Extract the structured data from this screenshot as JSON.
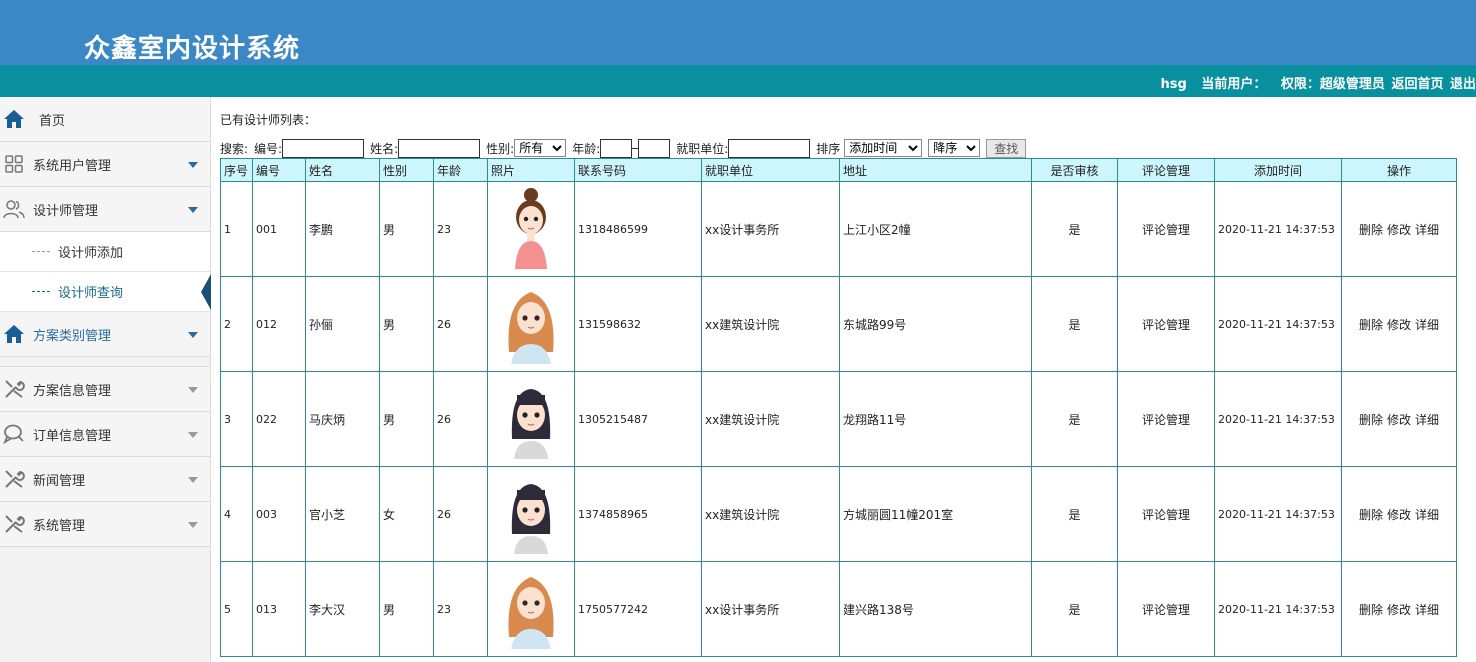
{
  "header": {
    "title": "众鑫室内设计系统",
    "username": "hsg",
    "current_user_label": "当前用户：",
    "role_label": "权限：超级管理员",
    "home_link": "返回首页",
    "logout_link": "退出"
  },
  "sidebar": {
    "home": "首页",
    "items": [
      {
        "label": "系统用户管理",
        "icon": "grid-icon"
      },
      {
        "label": "设计师管理",
        "icon": "users-icon"
      },
      {
        "label": "方案类别管理",
        "icon": "home-icon"
      },
      {
        "label": "方案信息管理",
        "icon": "tools-icon"
      },
      {
        "label": "订单信息管理",
        "icon": "chat-icon"
      },
      {
        "label": "新闻管理",
        "icon": "tools-icon"
      },
      {
        "label": "系统管理",
        "icon": "tools-icon"
      }
    ],
    "subitems": [
      "设计师添加",
      "设计师查询"
    ]
  },
  "main": {
    "caption": "已有设计师列表：",
    "search": {
      "label": "搜索:",
      "no_label": "编号:",
      "name_label": "姓名:",
      "sex_label": "性别:",
      "sex_value": "所有",
      "age_label": "年龄:",
      "unit_label": "就职单位:",
      "sort_label": "排序",
      "sort_value": "添加时间",
      "order_value": "降序",
      "button": "查找"
    },
    "columns": [
      "序号",
      "编号",
      "姓名",
      "性别",
      "年龄",
      "照片",
      "联系号码",
      "就职单位",
      "地址",
      "是否审核",
      "评论管理",
      "添加时间",
      "操作"
    ],
    "rows": [
      {
        "idx": "1",
        "no": "001",
        "name": "李鹏",
        "sex": "男",
        "age": "23",
        "phone": "1318486599",
        "unit": "xx设计事务所",
        "addr": "上江小区2幢",
        "audit": "是",
        "comment": "评论管理",
        "time": "2020-11-21 14:37:53",
        "photo": "avatar-bun"
      },
      {
        "idx": "2",
        "no": "012",
        "name": "孙俪",
        "sex": "男",
        "age": "26",
        "phone": "131598632",
        "unit": "xx建筑设计院",
        "addr": "东城路99号",
        "audit": "是",
        "comment": "评论管理",
        "time": "2020-11-21 14:37:53",
        "photo": "avatar-long"
      },
      {
        "idx": "3",
        "no": "022",
        "name": "马庆炳",
        "sex": "男",
        "age": "26",
        "phone": "1305215487",
        "unit": "xx建筑设计院",
        "addr": "龙翔路11号",
        "audit": "是",
        "comment": "评论管理",
        "time": "2020-11-21 14:37:53",
        "photo": "avatar-dark"
      },
      {
        "idx": "4",
        "no": "003",
        "name": "官小芝",
        "sex": "女",
        "age": "26",
        "phone": "1374858965",
        "unit": "xx建筑设计院",
        "addr": "方城丽圆11幢201室",
        "audit": "是",
        "comment": "评论管理",
        "time": "2020-11-21 14:37:53",
        "photo": "avatar-dark"
      },
      {
        "idx": "5",
        "no": "013",
        "name": "李大汉",
        "sex": "男",
        "age": "23",
        "phone": "1750577242",
        "unit": "xx设计事务所",
        "addr": "建兴路138号",
        "audit": "是",
        "comment": "评论管理",
        "time": "2020-11-21 14:37:53",
        "photo": "avatar-long"
      }
    ],
    "ops": [
      "删除",
      "修改",
      "详细"
    ]
  }
}
